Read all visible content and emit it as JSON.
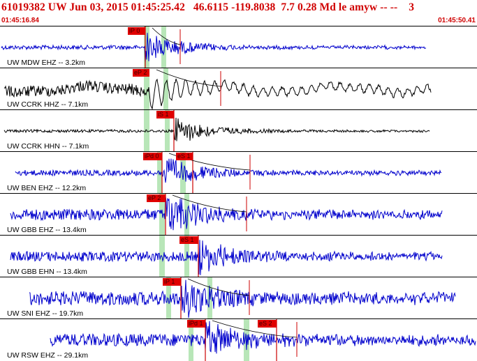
{
  "header": {
    "title": "61019382 UW Jun 03, 2015 01:45:25.42   46.6115 -119.8038  7.7 0.28 Md le amyw -- --    3",
    "time_start": "01:45:16.84",
    "time_end": "01:45:50.41"
  },
  "colors": {
    "header_text": "#d00000",
    "pick_fill": "#e00000",
    "vertical_trace": "#0000cc",
    "horizontal_trace": "#000000",
    "window_band": "#b8e6b8",
    "pick_line": "#cc0000"
  },
  "traces": [
    {
      "label": "UW MDW EHZ -- 3.2km",
      "color": "#0000cc",
      "picks": [
        {
          "text": "iP 0",
          "line": true
        }
      ],
      "band": [
        206,
        214
      ],
      "band2": [
        231,
        238
      ]
    },
    {
      "label": "UW CCRK HHZ -- 7.1km",
      "color": "#000000",
      "picks": [
        {
          "text": "eP 2",
          "line": false
        }
      ],
      "band": [
        206,
        214
      ],
      "band2": [
        234,
        241
      ]
    },
    {
      "label": "UW CCRK HHN -- 7.1km",
      "color": "#000000",
      "picks": [
        {
          "text": "iS 1",
          "line": true
        }
      ],
      "band": [
        206,
        214
      ],
      "band2": [
        236,
        243
      ]
    },
    {
      "label": "UW BEN EHZ -- 12.2km",
      "color": "#0000cc",
      "picks": [
        {
          "text": "iPd 0",
          "line": true
        },
        {
          "text": "eS 1",
          "line": true
        }
      ],
      "band": [
        225,
        232
      ],
      "band2": [
        258,
        266
      ]
    },
    {
      "label": "UW GBB EHZ -- 13.4km",
      "color": "#0000cc",
      "picks": [
        {
          "text": "eP 2",
          "line": true
        }
      ],
      "band": [
        228,
        236
      ],
      "band2": [
        264,
        271
      ]
    },
    {
      "label": "UW GBB EHN -- 13.4km",
      "color": "#0000cc",
      "picks": [
        {
          "text": "eS 1",
          "line": true
        }
      ],
      "band": [
        228,
        236
      ],
      "band2": [
        264,
        271
      ]
    },
    {
      "label": "UW SNI EHZ -- 19.7km",
      "color": "#0000cc",
      "picks": [
        {
          "text": "iP 1",
          "line": true
        }
      ],
      "band": [
        238,
        245
      ],
      "band2": [
        297,
        304
      ]
    },
    {
      "label": "UW RSW EHZ -- 29.1km",
      "color": "#0000cc",
      "picks": [
        {
          "text": "iPd 1",
          "line": true
        },
        {
          "text": "eS 2",
          "line": true
        }
      ],
      "band": [
        270,
        277
      ],
      "band2": [
        349,
        357
      ]
    }
  ]
}
